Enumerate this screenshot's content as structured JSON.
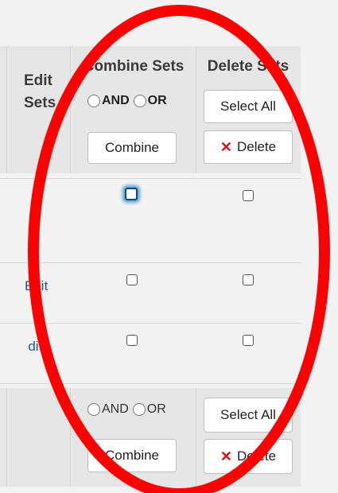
{
  "header": {
    "edit_sets_line1": "Edit",
    "edit_sets_line2": "Sets",
    "combine_sets_title": "Combine Sets",
    "delete_sets_title": "Delete Sets",
    "and_label": "AND",
    "or_label": "OR",
    "combine_button": "Combine",
    "select_all_button": "Select All",
    "delete_button": "Delete"
  },
  "rows": [
    {
      "edit_link": "",
      "combine_checked": false,
      "delete_checked": false
    },
    {
      "edit_link": "Edit",
      "combine_checked": false,
      "delete_checked": false
    },
    {
      "edit_link": "Edit",
      "combine_checked": false,
      "delete_checked": false
    }
  ],
  "footer": {
    "and_label": "AND",
    "or_label": "OR",
    "combine_button": "Combine",
    "select_all_button": "Select All",
    "delete_button": "Delete"
  },
  "colors": {
    "highlight_ellipse": "#ff0000",
    "link": "#1d5a8a",
    "delete_x": "#dd1111",
    "focus_ring": "#5ba3d0"
  }
}
